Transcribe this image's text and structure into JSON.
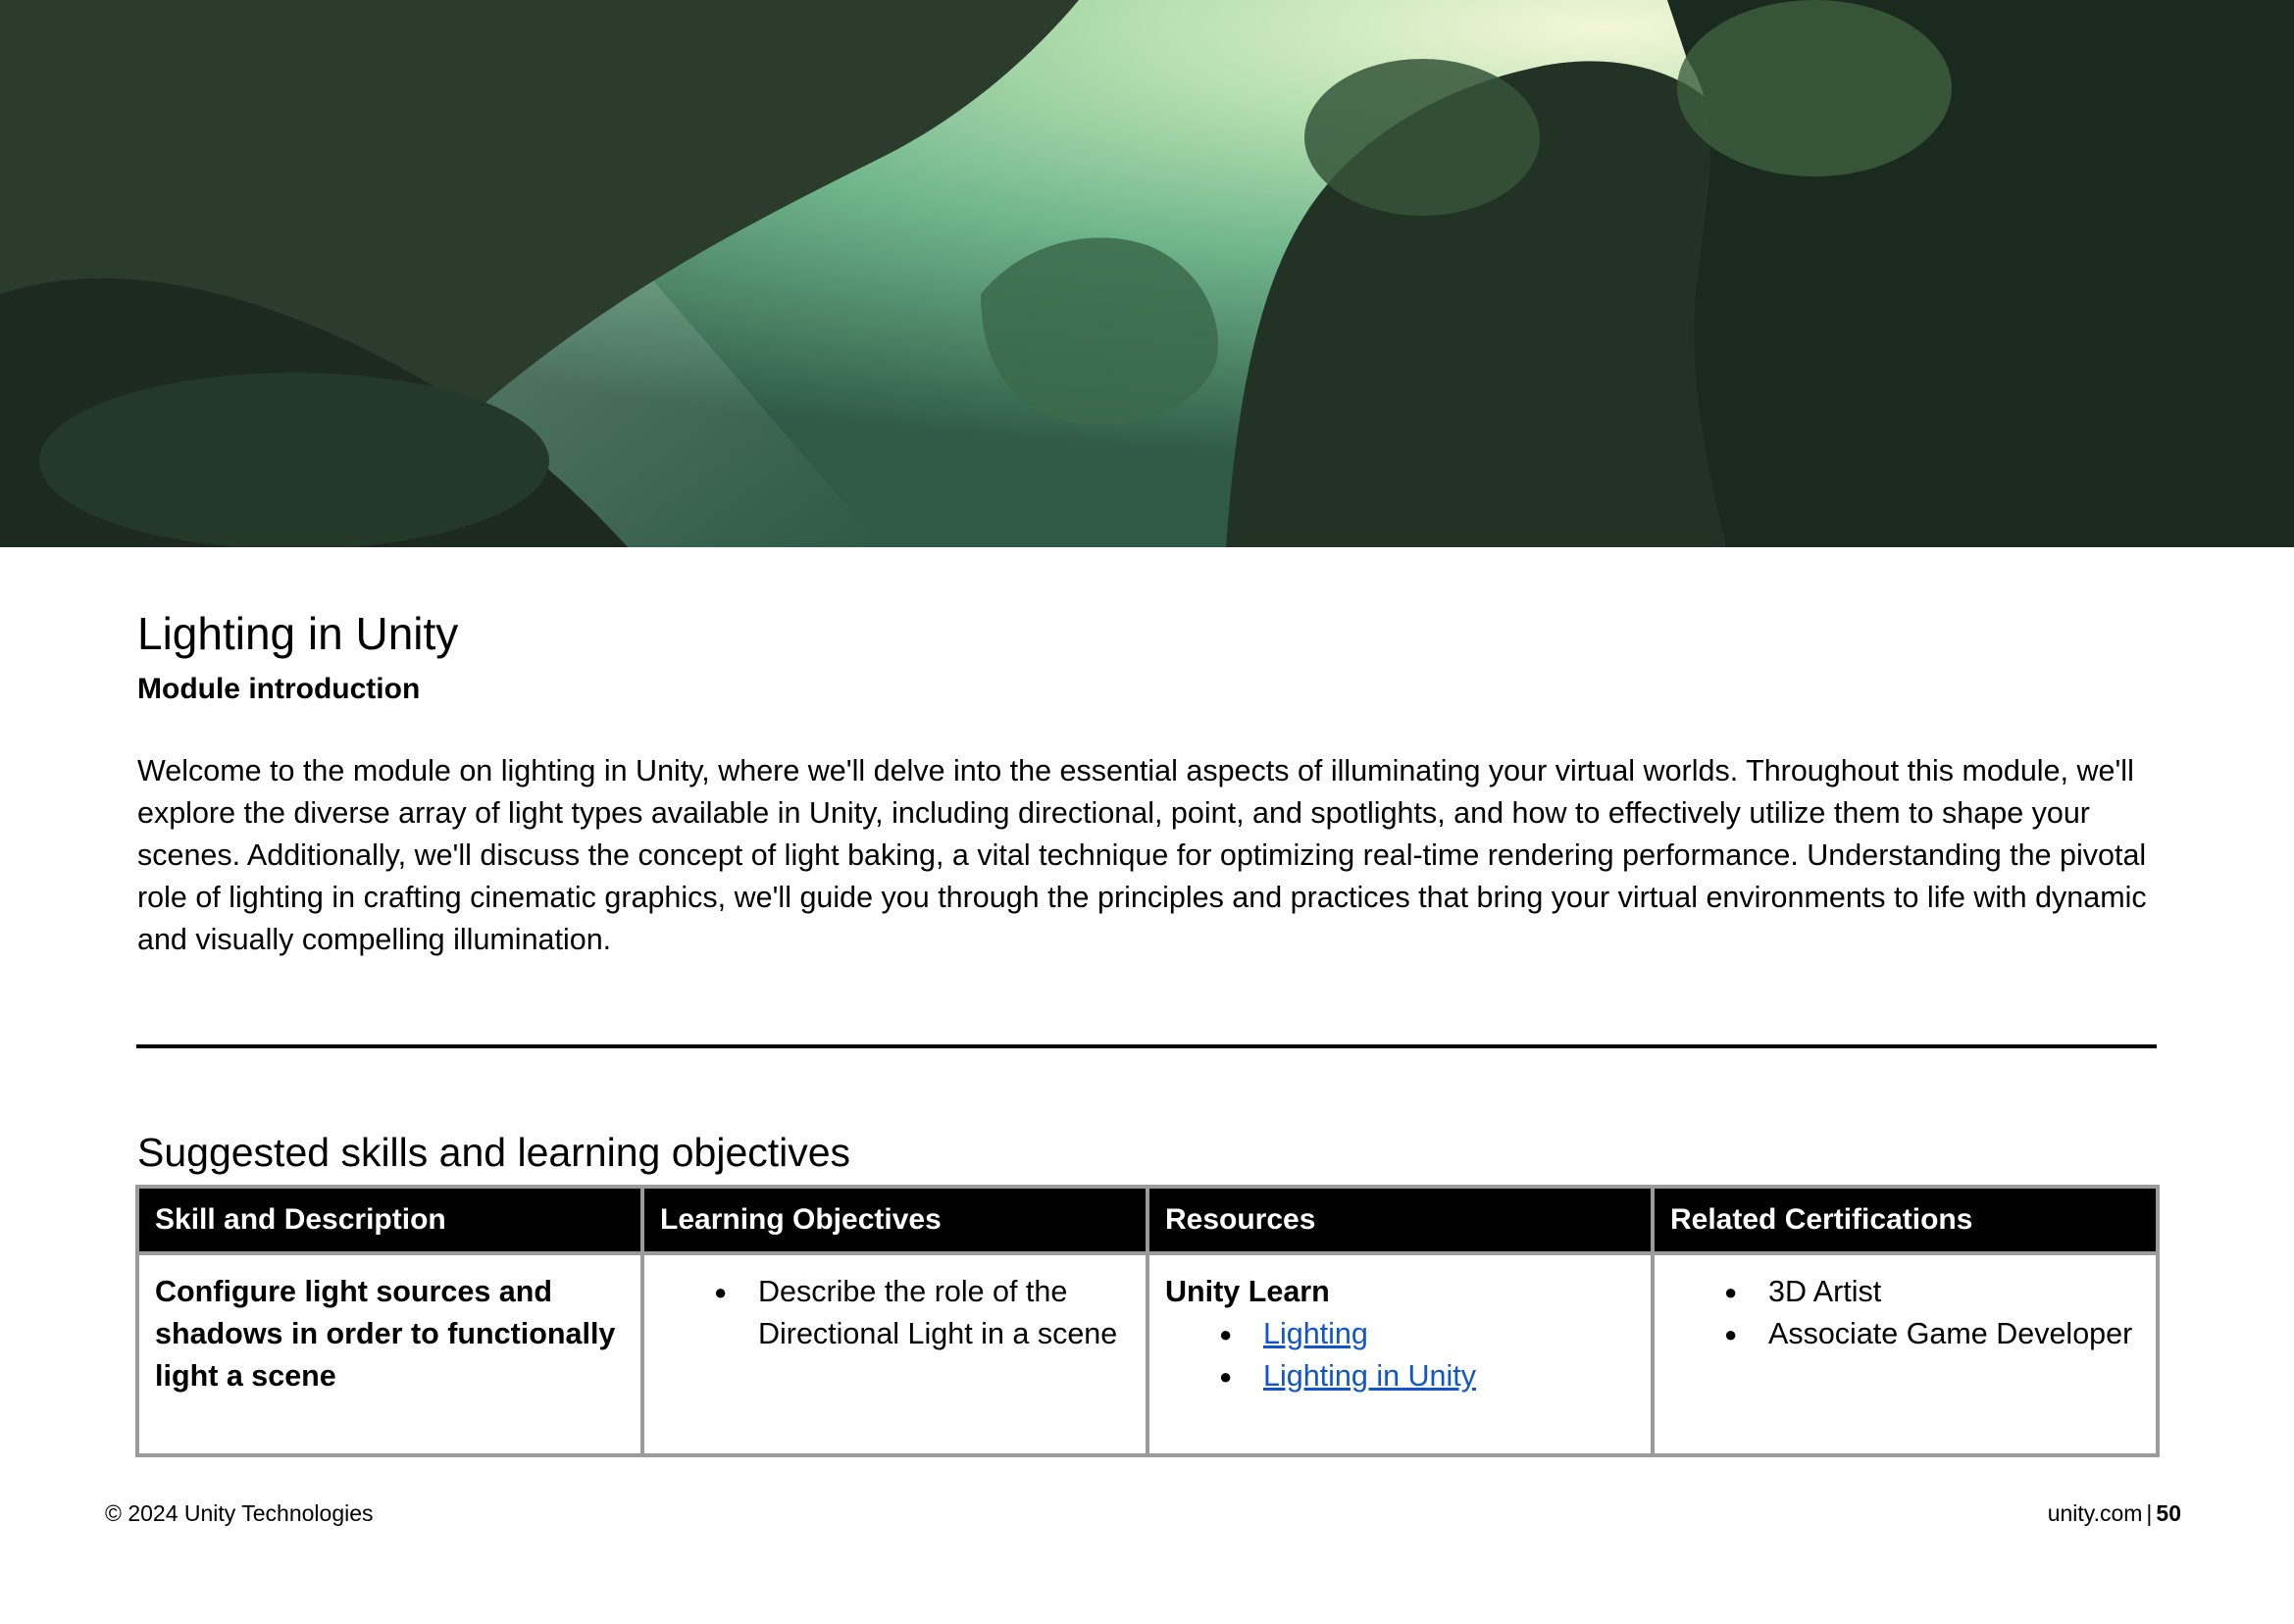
{
  "hero": {
    "alt": "Jungle cliffs with sunlight streaming through foliage"
  },
  "module": {
    "title": "Lighting in Unity",
    "subtitle": "Module introduction",
    "intro": "Welcome to the module on lighting in Unity, where we'll delve into the essential aspects of illuminating your virtual worlds. Throughout this module, we'll explore the diverse array of light types available in Unity, including directional, point, and spotlights, and how to effectively utilize them to shape your scenes. Additionally, we'll discuss the concept of light baking, a vital technique for optimizing real-time rendering performance. Understanding the pivotal role of lighting in crafting cinematic graphics, we'll guide you through the principles and practices that bring your virtual environments to life with dynamic and visually compelling illumination."
  },
  "skills_section": {
    "title": "Suggested skills and learning objectives",
    "headers": [
      "Skill and Description",
      "Learning Objectives",
      "Resources",
      "Related Certifications"
    ],
    "row": {
      "skill": "Configure light sources and shadows in order to functionally light a scene",
      "objectives": [
        "Describe the role of the Directional Light in a scene"
      ],
      "resources_heading": "Unity Learn",
      "resources": [
        "Lighting",
        "Lighting in Unity"
      ],
      "certifications": [
        "3D Artist",
        "Associate Game Developer"
      ]
    }
  },
  "footer": {
    "copyright": "© 2024 Unity Technologies",
    "site": "unity.com",
    "separator": "|",
    "page": "50"
  },
  "colors": {
    "link": "#1155cc",
    "header_bg": "#000000",
    "table_border": "#9b9b9b"
  }
}
